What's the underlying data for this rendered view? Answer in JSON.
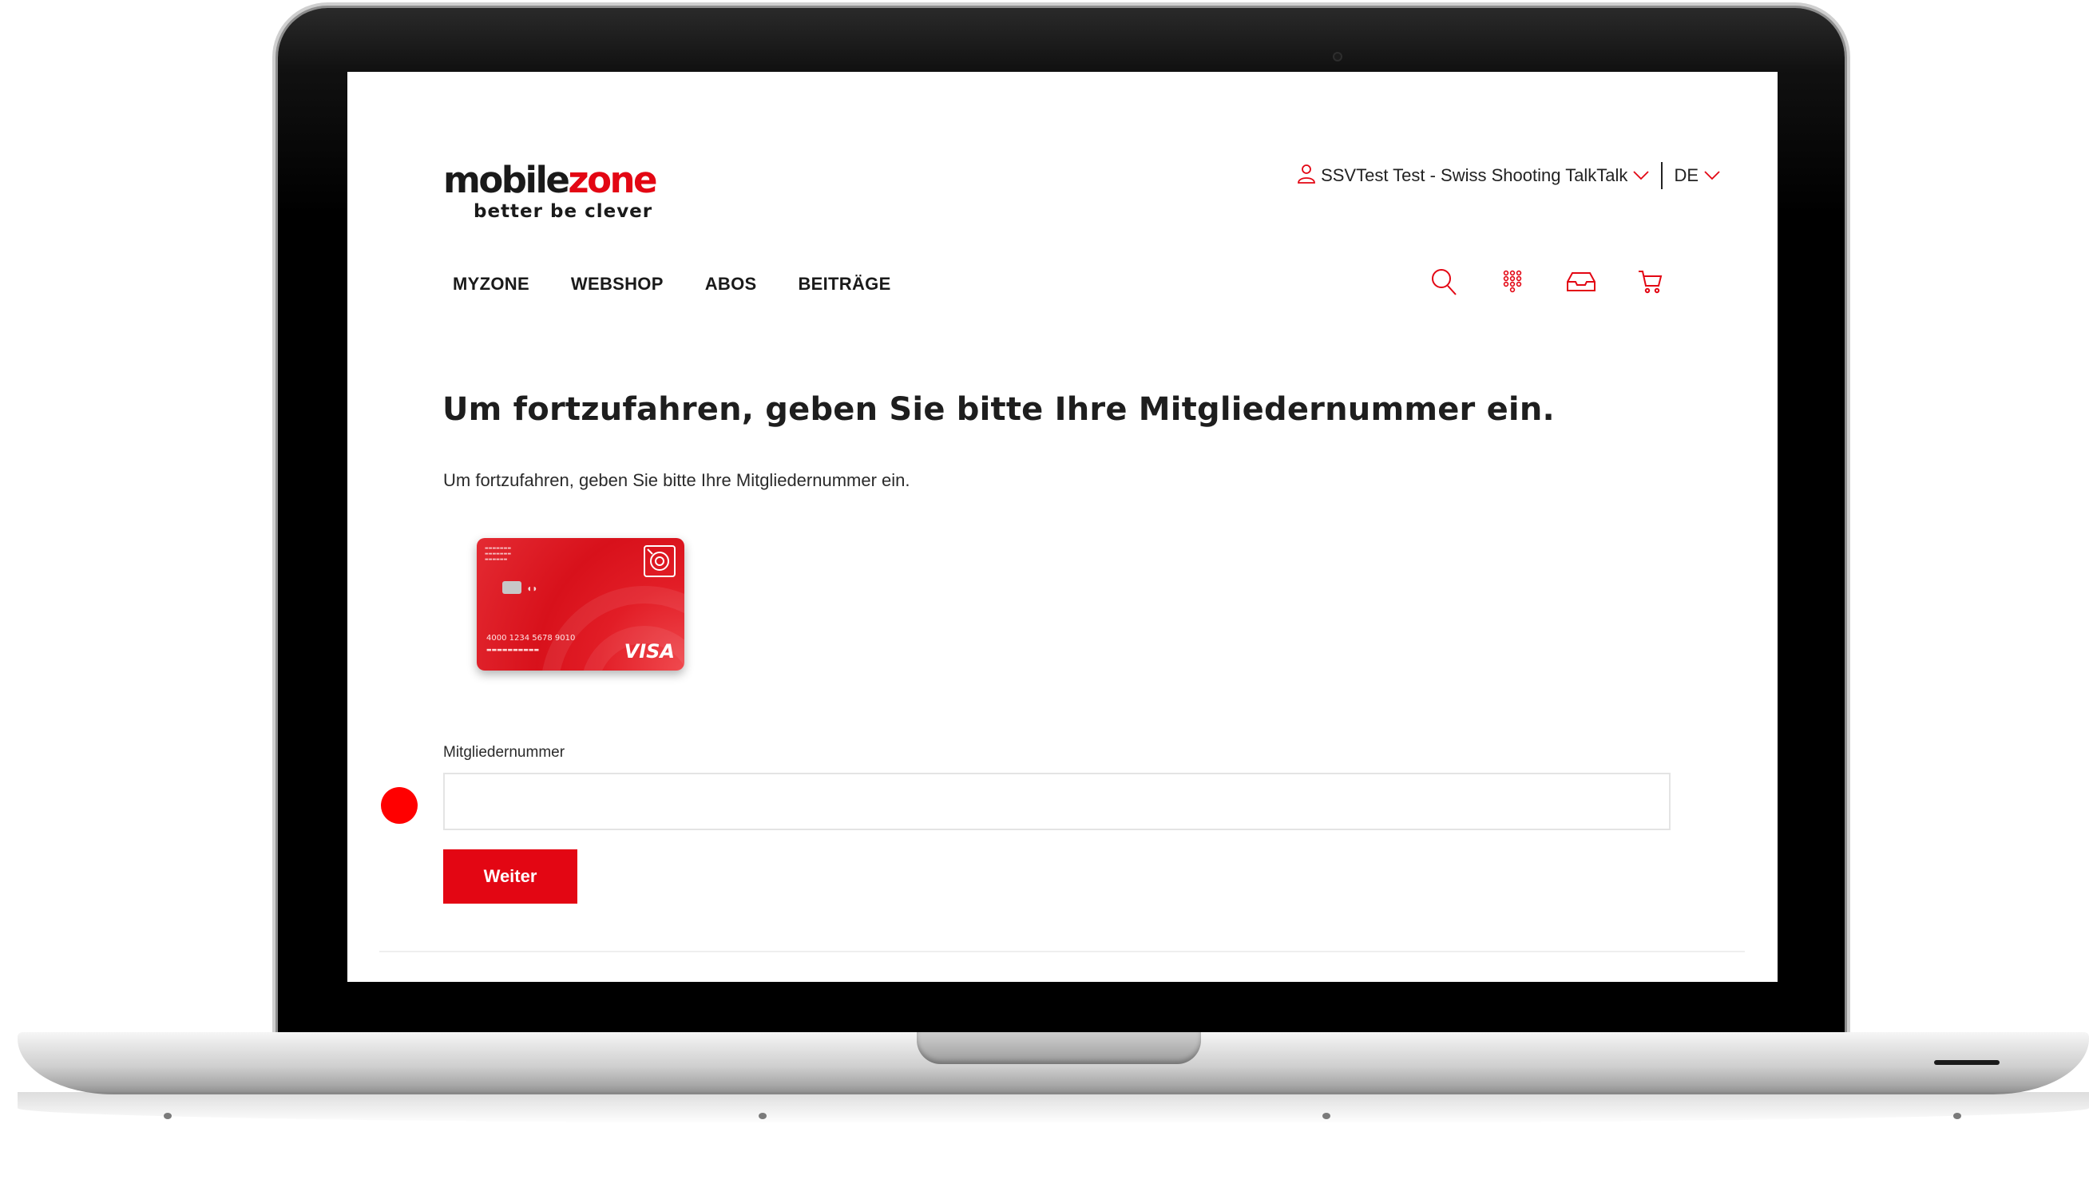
{
  "brand": {
    "logo_part1": "mobile",
    "logo_part2": "zone",
    "tagline": "better be clever",
    "accent_color": "#e30613"
  },
  "header": {
    "user_icon": "user-icon",
    "user_label": "SSVTest Test - Swiss Shooting TalkTalk",
    "language": "DE"
  },
  "nav": {
    "items": [
      {
        "label": "MYZONE"
      },
      {
        "label": "WEBSHOP"
      },
      {
        "label": "ABOS"
      },
      {
        "label": "BEITRÄGE"
      }
    ]
  },
  "toolbar": {
    "icons": [
      "search-icon",
      "grid-menu-icon",
      "inbox-icon",
      "cart-icon"
    ]
  },
  "main": {
    "heading": "Um fortzufahren, geben Sie bitte Ihre Mitgliedernummer ein.",
    "subtext": "Um fortzufahren, geben Sie bitte Ihre Mitgliedernummer ein.",
    "card": {
      "number": "4000 1234 5678 9010",
      "brand": "VISA"
    },
    "form": {
      "label": "Mitgliedernummer",
      "value": "",
      "submit_label": "Weiter"
    }
  }
}
